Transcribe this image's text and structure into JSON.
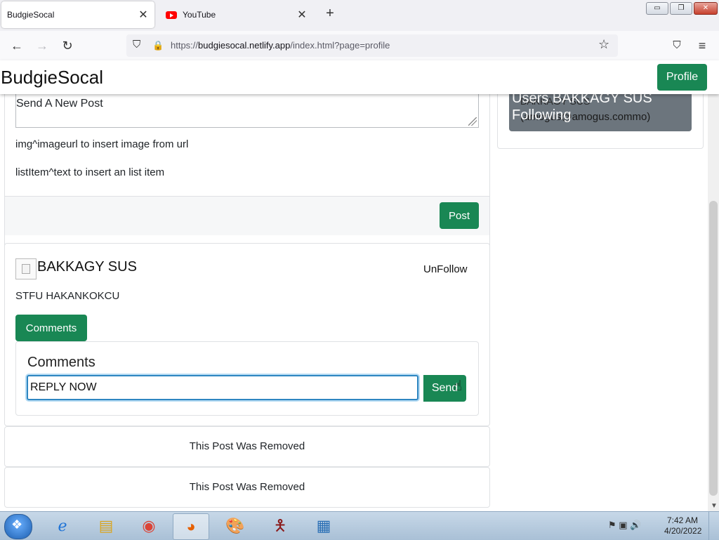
{
  "browser": {
    "tabs": [
      {
        "label": "BudgieSocal",
        "active": true
      },
      {
        "label": "YouTube",
        "active": false
      }
    ],
    "new_tab": "+",
    "url": {
      "prefix": "https://",
      "host": "budgiesocal.netlify.app",
      "path": "/index.html?page=profile"
    },
    "window_buttons": {
      "minimize": "▭",
      "restore": "❐",
      "close": "✕"
    },
    "nav": {
      "back": "←",
      "forward": "→",
      "reload": "↻",
      "tracking": "⛉",
      "lock": "🔒",
      "bookmark": "☆",
      "pocket": "⛉",
      "menu": "≡"
    }
  },
  "app": {
    "brand": "BudgieSocal",
    "profile_button": "Profile"
  },
  "compose": {
    "textarea_value": "Send A New Post",
    "hint_image": "img^imageurl to insert image from url",
    "hint_list": "listItem^text to insert an list item",
    "post_button": "Post"
  },
  "post": {
    "author": "BAKKAGY SUS",
    "unfollow_button": "UnFollow",
    "text": "STFU HAKANKOKCU",
    "comments_button": "Comments",
    "comments_title": "Comments",
    "reply_value": "REPLY NOW",
    "send_button": "Send"
  },
  "removed_posts": [
    {
      "text": "This Post Was Removed"
    },
    {
      "text": "This Post Was Removed"
    }
  ],
  "sidebar": {
    "overlay_line1": "Users BAKKAGY SUS",
    "overlay_line2": "Following",
    "under_name": "BAKKAGY SUS",
    "under_email": "(amogus@amogus.commo)"
  },
  "taskbar": {
    "clock_time": "7:42 AM",
    "clock_date": "4/20/2022",
    "apps": [
      "internet-explorer",
      "file-explorer",
      "chrome",
      "firefox",
      "paint",
      "stickman-app",
      "control-panel"
    ]
  },
  "colors": {
    "primary_green": "#198754",
    "focus_blue": "#2e86c1",
    "follow_gray": "#6c757d"
  }
}
